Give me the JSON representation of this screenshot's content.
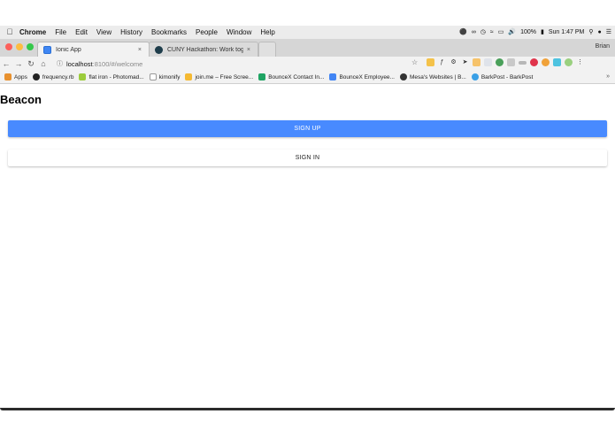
{
  "mac_menu": {
    "app_name": "Chrome",
    "items": [
      "File",
      "Edit",
      "View",
      "History",
      "Bookmarks",
      "People",
      "Window",
      "Help"
    ],
    "battery": "100%",
    "clock": "Sun 1:47 PM"
  },
  "browser": {
    "tabs": [
      {
        "title": "Ionic App",
        "close": "×"
      },
      {
        "title": "CUNY Hackathon: Work togeth",
        "close": "×"
      }
    ],
    "profile_name": "Brian",
    "url_host": "localhost",
    "url_path": ":8100/#/welcome",
    "bookmarks": [
      "Apps",
      "frequency.rb",
      "flat iron - Photomad...",
      "kimonify",
      "join.me – Free Scree...",
      "BounceX Contact In...",
      "BounceX Employee...",
      "Mesa's Websites | B...",
      "BarkPost - BarkPost"
    ],
    "bookmarks_more": "»"
  },
  "page": {
    "title": "Beacon",
    "sign_up_label": "SIGN UP",
    "sign_in_label": "SIGN IN"
  },
  "icons": {
    "apple": "apple-icon",
    "back": "back-arrow-icon",
    "forward": "forward-arrow-icon",
    "reload": "reload-icon",
    "home": "home-icon",
    "info": "info-icon",
    "star": "bookmark-star-icon"
  },
  "colors": {
    "primary_button": "#488aff",
    "tab_active_bg": "#f2f2f2"
  }
}
